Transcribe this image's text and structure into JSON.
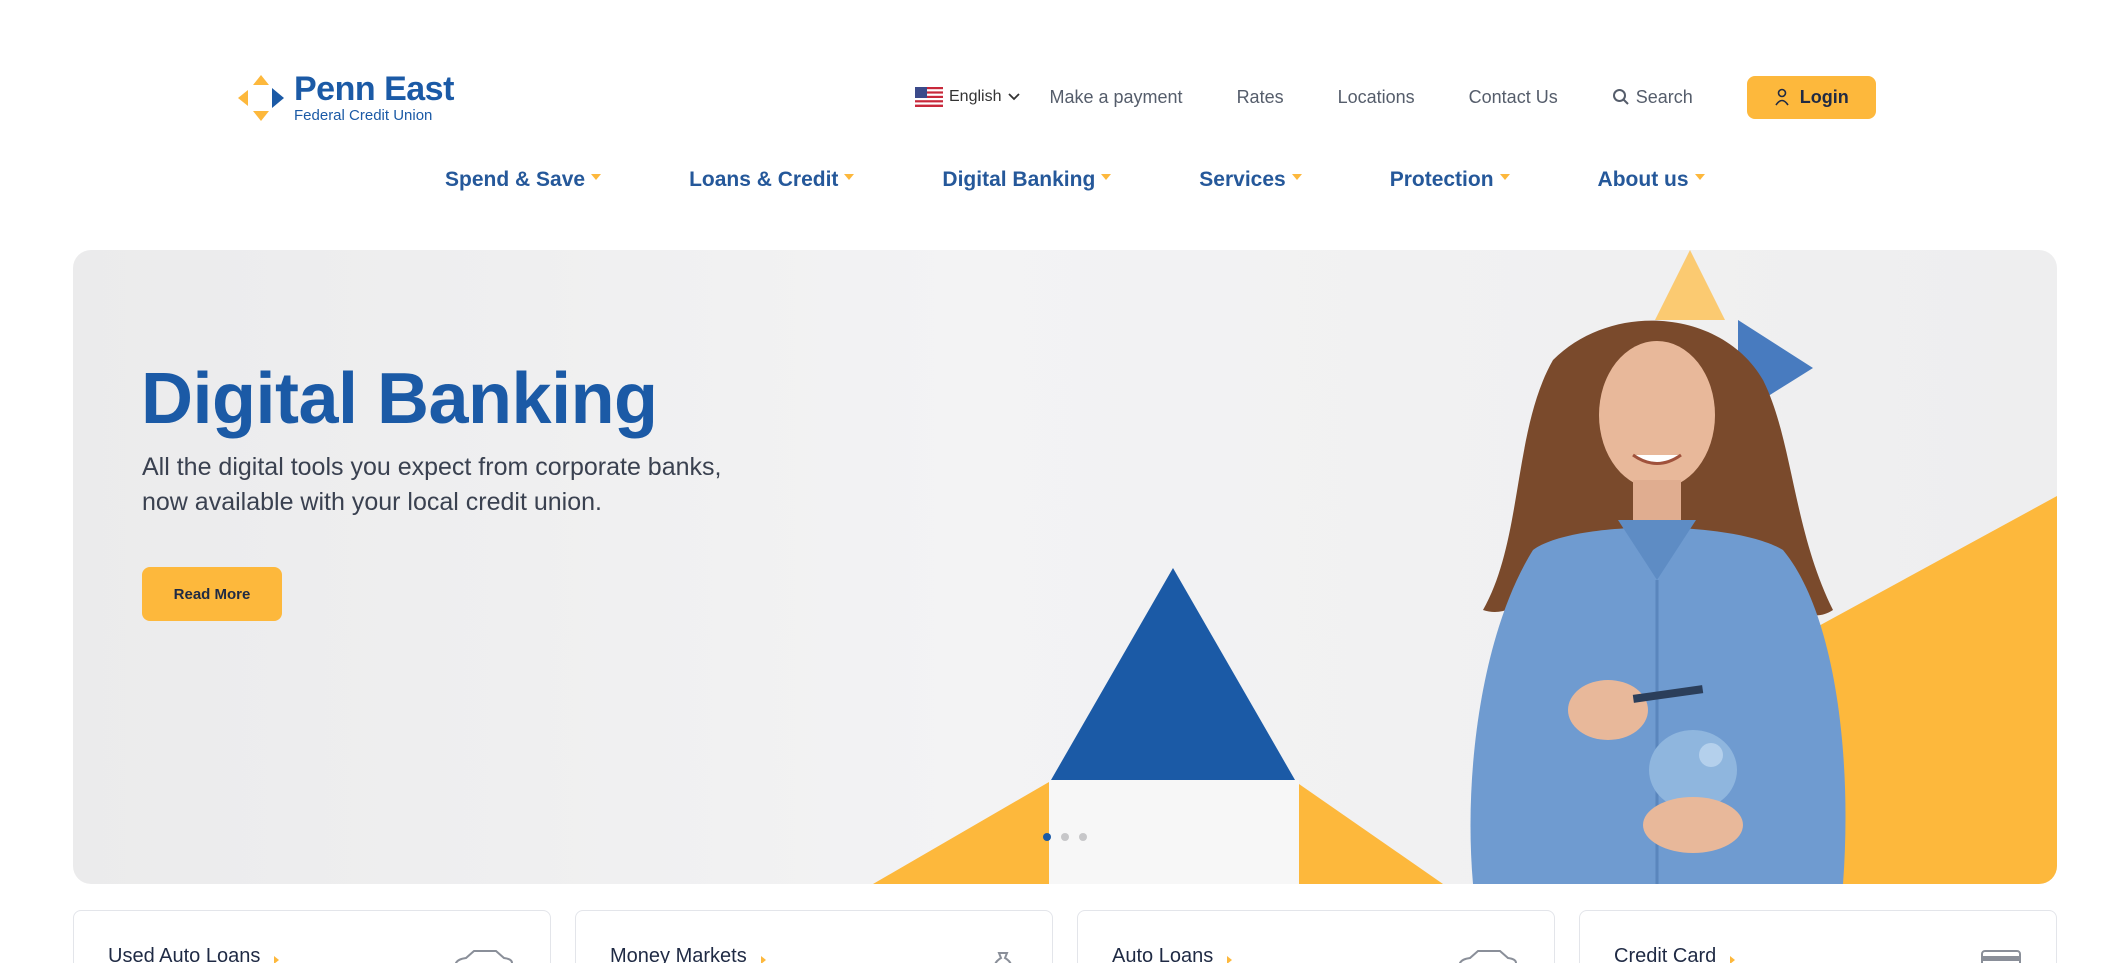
{
  "brand": {
    "name": "Penn East",
    "subtitle": "Federal Credit Union"
  },
  "topnav": {
    "language": "English",
    "make_payment": "Make a payment",
    "rates": "Rates",
    "locations": "Locations",
    "contact": "Contact Us",
    "search": "Search",
    "login": "Login"
  },
  "mainnav": [
    {
      "label": "Spend & Save"
    },
    {
      "label": "Loans & Credit"
    },
    {
      "label": "Digital Banking"
    },
    {
      "label": "Services"
    },
    {
      "label": "Protection"
    },
    {
      "label": "About us"
    }
  ],
  "hero": {
    "title": "Digital Banking",
    "subtitle_line1": "All the digital tools you expect from corporate banks,",
    "subtitle_line2": "now available with your local credit union.",
    "button": "Read More",
    "slide_count": 3,
    "active_slide": 1
  },
  "cards": [
    {
      "label": "Used Auto Loans",
      "icon": "car-icon"
    },
    {
      "label": "Money Markets",
      "icon": "money-bag-icon"
    },
    {
      "label": "Auto Loans",
      "icon": "car-icon"
    },
    {
      "label": "Credit Card",
      "icon": "credit-card-icon"
    }
  ],
  "colors": {
    "brand_blue": "#1b5aa6",
    "accent_yellow": "#fdb83c"
  }
}
